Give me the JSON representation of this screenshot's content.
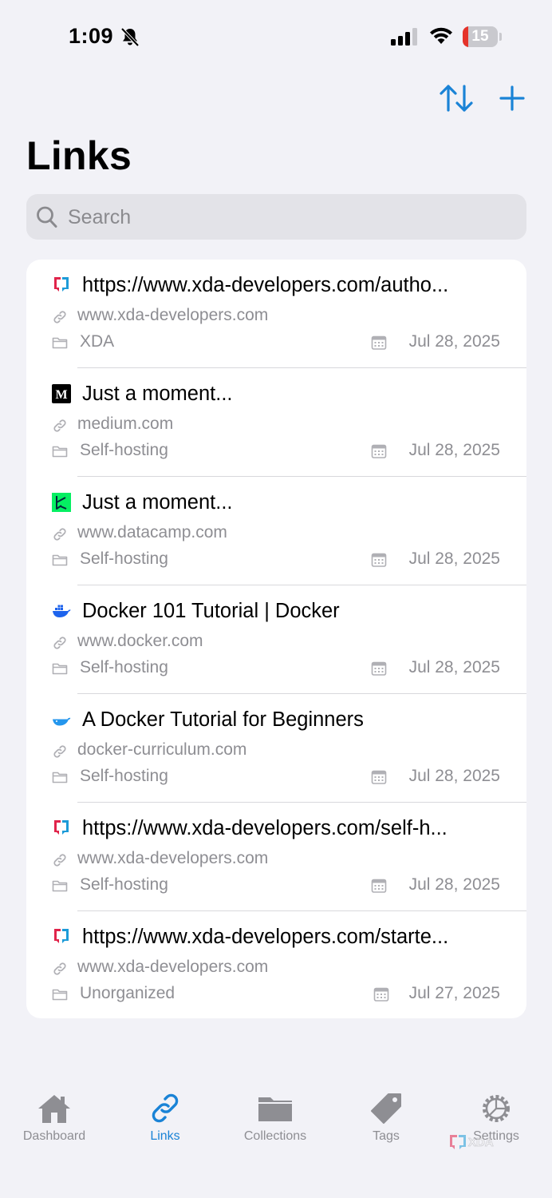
{
  "status_bar": {
    "time": "1:09",
    "battery": "15",
    "battery_level": 0.15
  },
  "header": {
    "title": "Links"
  },
  "search": {
    "placeholder": "Search"
  },
  "links": [
    {
      "favicon": "xda-icon",
      "title": "https://www.xda-developers.com/autho...",
      "url": "www.xda-developers.com",
      "collection": "XDA",
      "date": "Jul 28, 2025"
    },
    {
      "favicon": "medium-icon",
      "title": "Just a moment...",
      "url": "medium.com",
      "collection": "Self-hosting",
      "date": "Jul 28, 2025"
    },
    {
      "favicon": "datacamp-icon",
      "title": "Just a moment...",
      "url": "www.datacamp.com",
      "collection": "Self-hosting",
      "date": "Jul 28, 2025"
    },
    {
      "favicon": "docker-icon",
      "title": "Docker 101 Tutorial | Docker",
      "url": "www.docker.com",
      "collection": "Self-hosting",
      "date": "Jul 28, 2025"
    },
    {
      "favicon": "docker-icon",
      "title": "A Docker Tutorial for Beginners",
      "url": "docker-curriculum.com",
      "collection": "Self-hosting",
      "date": "Jul 28, 2025"
    },
    {
      "favicon": "xda-icon",
      "title": "https://www.xda-developers.com/self-h...",
      "url": "www.xda-developers.com",
      "collection": "Self-hosting",
      "date": "Jul 28, 2025"
    },
    {
      "favicon": "xda-icon",
      "title": "https://www.xda-developers.com/starte...",
      "url": "www.xda-developers.com",
      "collection": "Unorganized",
      "date": "Jul 27, 2025"
    }
  ],
  "tabs": [
    {
      "label": "Dashboard",
      "icon": "house-icon",
      "active": false
    },
    {
      "label": "Links",
      "icon": "link-icon",
      "active": true
    },
    {
      "label": "Collections",
      "icon": "folder-icon",
      "active": false
    },
    {
      "label": "Tags",
      "icon": "tag-icon",
      "active": false
    },
    {
      "label": "Settings",
      "icon": "gear-icon",
      "active": false
    }
  ],
  "colors": {
    "accent": "#1a83d6",
    "background": "#f2f2f7",
    "secondary_text": "#8e8e93"
  }
}
